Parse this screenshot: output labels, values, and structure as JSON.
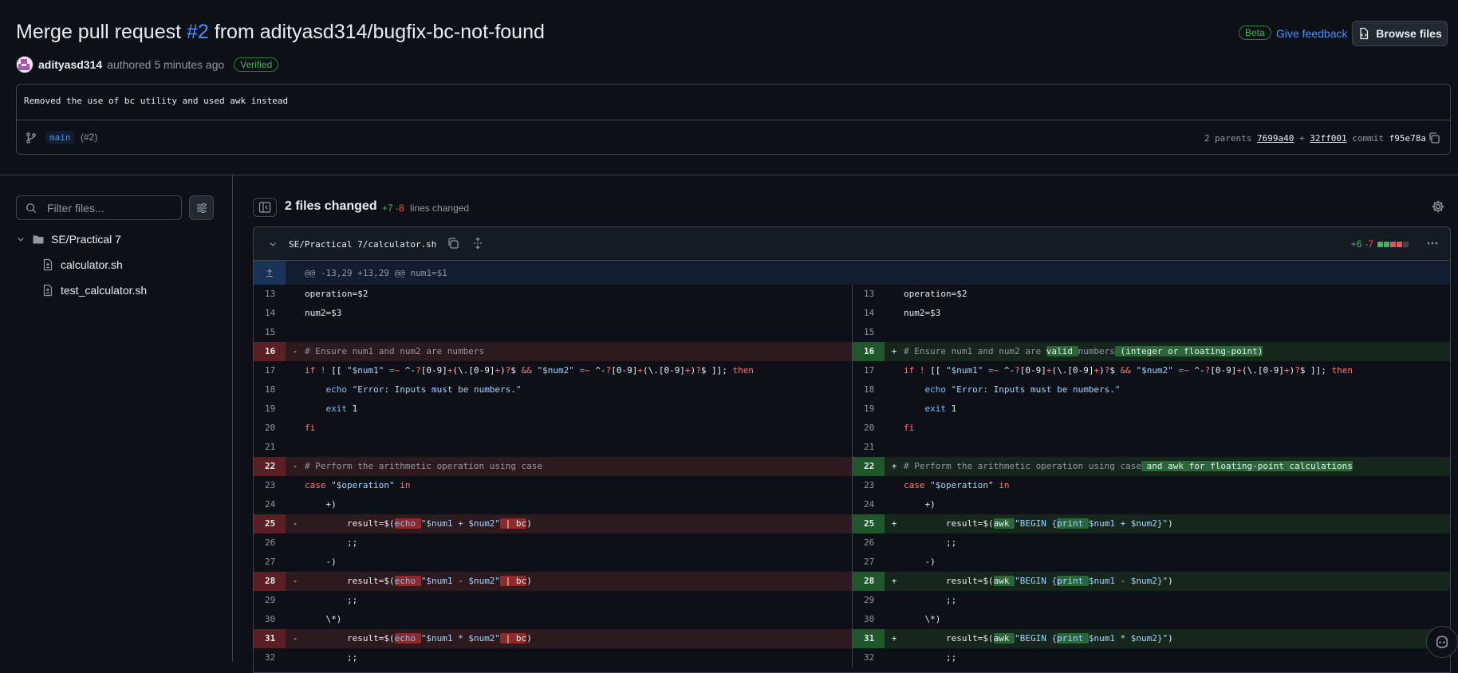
{
  "header": {
    "title_prefix": "Merge pull request ",
    "pr_number": "#2",
    "title_suffix": " from adityasd314/bugfix-bc-not-found",
    "author": "adityasd314",
    "authored_text": "authored 5 minutes ago",
    "verified_badge": "Verified",
    "beta_badge": "Beta",
    "feedback_link": "Give feedback",
    "browse_files": "Browse files"
  },
  "commit": {
    "message": "Removed the use of bc utility and used awk instead",
    "branch": "main",
    "pr_ref": "(#2)",
    "parents_label": "2 parents",
    "parent_1": "7699a40",
    "plus": "+",
    "parent_2": "32ff001",
    "commit_label": "commit",
    "commit_sha": "f95e78a"
  },
  "sidebar": {
    "filter_placeholder": "Filter files...",
    "folder": "SE/Practical 7",
    "files": [
      "calculator.sh",
      "test_calculator.sh"
    ]
  },
  "summary": {
    "files_changed": "2 files changed",
    "additions": "+7",
    "deletions": "-8",
    "lines_changed": "lines changed"
  },
  "file": {
    "path": "SE/Practical 7/calculator.sh",
    "additions": "+6",
    "deletions": "-7",
    "hunk_header": "@@ -13,29 +13,29 @@ num1=$1"
  },
  "line_numbers": [
    "13",
    "14",
    "15",
    "16",
    "17",
    "18",
    "19",
    "20",
    "21",
    "22",
    "23",
    "24",
    "25",
    "26",
    "27",
    "28",
    "29",
    "30",
    "31",
    "32"
  ],
  "icons": {
    "branch": "git-branch-icon",
    "copy": "copy-icon",
    "search": "search-icon",
    "settings": "gear-icon",
    "folder": "folder-icon",
    "file": "file-diff-icon",
    "copilot": "copilot-icon"
  },
  "colors": {
    "background": "#0d1117",
    "accent": "#4493f8",
    "addition": "#3fb950",
    "deletion": "#f85149"
  }
}
